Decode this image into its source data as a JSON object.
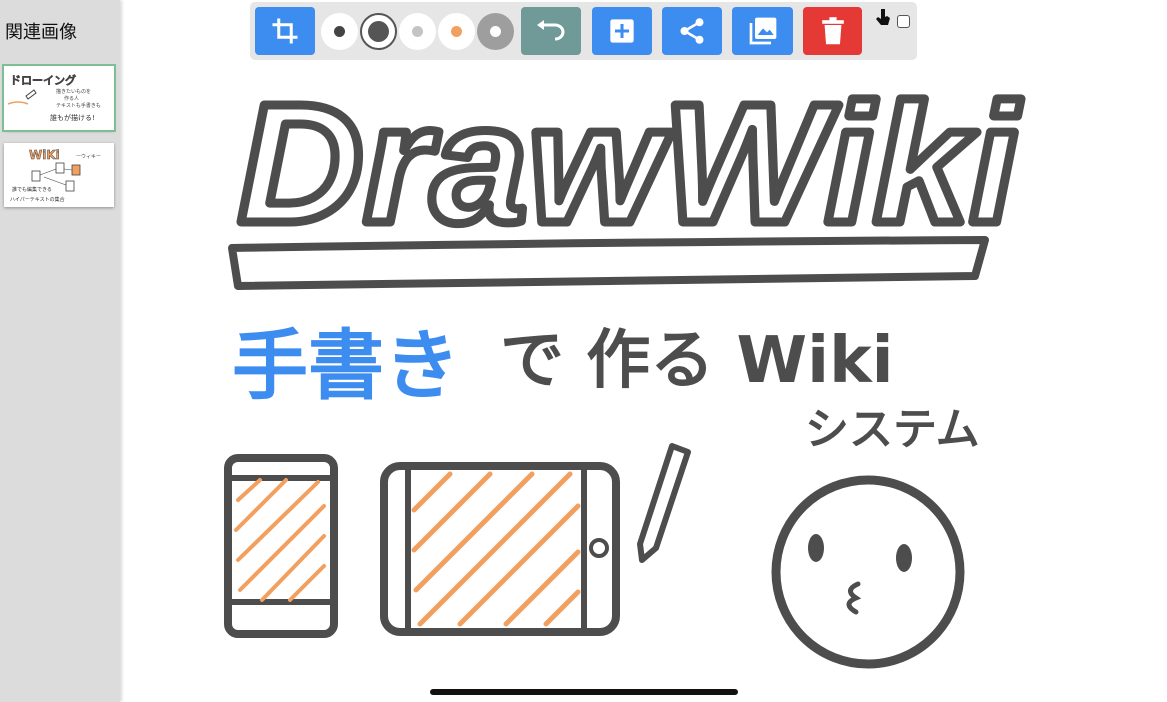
{
  "sidebar": {
    "title": "関連画像"
  },
  "thumbnails": [
    {
      "title": "ドローイング",
      "lines": [
        "描きたいものを",
        "作る人",
        "テキストも手書きも",
        "誰もが描ける!"
      ]
    },
    {
      "title": "WiKi",
      "subtitle": "ーウィキー",
      "lines": [
        "誰でも編集できる",
        "ハイパーテキストの集合"
      ]
    }
  ],
  "toolbar": {
    "tools": [
      "crop-icon",
      "pen-size-small",
      "pen-size-large",
      "pen-color-lightgray",
      "pen-color-orange",
      "pen-color-gray",
      "undo-icon",
      "add-icon",
      "share-icon",
      "image-icon",
      "trash-icon",
      "touch-icon"
    ],
    "colors": {
      "blue": "#3d8cf0",
      "teal": "#6f9a98",
      "red": "#e53935",
      "orange": "#f2a060",
      "gray": "#555555"
    }
  },
  "canvas": {
    "title": "DrawWiki",
    "tagline_blue": "手書き",
    "tagline_rest": "で 作る Wiki",
    "tagline_sub": "システム"
  }
}
